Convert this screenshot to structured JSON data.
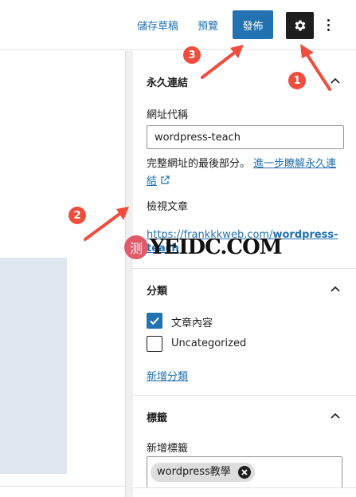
{
  "toolbar": {
    "save_draft_label": "儲存草稿",
    "preview_label": "預覽",
    "publish_label": "發佈",
    "settings_icon": "gear-icon",
    "more_icon": "vertical-ellipsis-icon"
  },
  "permalink_panel": {
    "title": "永久連結",
    "slug_label": "網址代稱",
    "slug_value": "wordpress-teach",
    "help_text": "完整網址的最後部分。",
    "help_link": "進一步瞭解永久連結",
    "view_post_label": "檢視文章",
    "post_url_prefix": "https://frankkkweb.com/",
    "post_url_slug": "wordpress-teach"
  },
  "categories_panel": {
    "title": "分類",
    "items": [
      {
        "label": "文章內容",
        "checked": true
      },
      {
        "label": "Uncategorized",
        "checked": false
      }
    ],
    "add_new_label": "新增分類"
  },
  "tags_panel": {
    "title": "標籤",
    "add_tag_label": "新增標籤",
    "tags": [
      "wordpress教學"
    ]
  },
  "watermark": {
    "seal": "测",
    "text": "YEIDC.COM"
  },
  "annotations": {
    "badges": [
      "1",
      "2",
      "3"
    ],
    "color": "#ef4d3d"
  },
  "colors": {
    "accent": "#2271b1",
    "dark": "#1e1e1e",
    "editor_block": "#dde8f0"
  }
}
